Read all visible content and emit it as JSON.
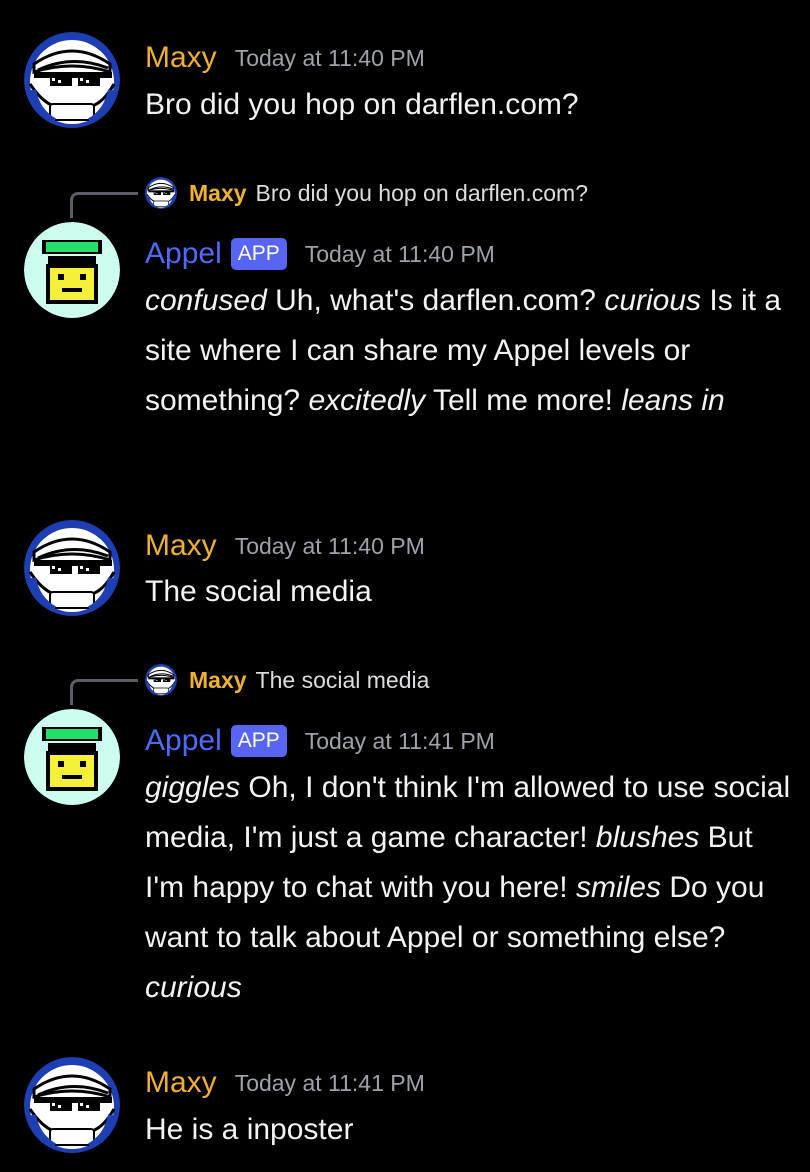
{
  "messages": [
    {
      "author": "Maxy",
      "timestamp": "Today at 11:40 PM",
      "avatar_badge": "kettle",
      "segments": [
        {
          "text": "Bro did you hop on darflen.com?",
          "italic": false
        }
      ]
    },
    {
      "reply": {
        "author": "Maxy",
        "text": "Bro did you hop on darflen.com?"
      },
      "author": "Appel",
      "badge": "APP",
      "timestamp": "Today at 11:40 PM",
      "segments": [
        {
          "text": "confused",
          "italic": true
        },
        {
          "text": " Uh, what's darflen.com? ",
          "italic": false
        },
        {
          "text": "curious",
          "italic": true
        },
        {
          "text": " Is it a site where I can share my Appel levels or something? ",
          "italic": false
        },
        {
          "text": "excitedly",
          "italic": true
        },
        {
          "text": " Tell me more! ",
          "italic": false
        },
        {
          "text": "leans in",
          "italic": true
        }
      ]
    },
    {
      "author": "Maxy",
      "timestamp": "Today at 11:40 PM",
      "avatar_badge": "kettle",
      "segments": [
        {
          "text": "The social media",
          "italic": false
        }
      ]
    },
    {
      "reply": {
        "author": "Maxy",
        "text": "The social media"
      },
      "author": "Appel",
      "badge": "APP",
      "timestamp": "Today at 11:41 PM",
      "segments": [
        {
          "text": "giggles",
          "italic": true
        },
        {
          "text": " Oh, I don't think I'm allowed to use social media, I'm just a game character! ",
          "italic": false
        },
        {
          "text": "blushes",
          "italic": true
        },
        {
          "text": " But I'm happy to chat with you here! ",
          "italic": false
        },
        {
          "text": "smiles",
          "italic": true
        },
        {
          "text": " Do you want to talk about Appel or something else? ",
          "italic": false
        },
        {
          "text": "curious",
          "italic": true
        }
      ]
    },
    {
      "author": "Maxy",
      "timestamp": "Today at 11:41 PM",
      "avatar_badge": "kettle",
      "segments": [
        {
          "text": "He is a inposter",
          "italic": false
        }
      ]
    }
  ],
  "colors": {
    "background": "#000000",
    "maxy_name": "#f0b132",
    "appel_name": "#4f6bff",
    "app_badge": "#5865f2",
    "timestamp": "#9ea3ab",
    "text": "#f2f3f5"
  },
  "icons": {
    "maxy_avatar": "maxy-avatar-icon",
    "appel_avatar": "appel-avatar-icon",
    "reply_spine": "reply-spine-icon"
  }
}
